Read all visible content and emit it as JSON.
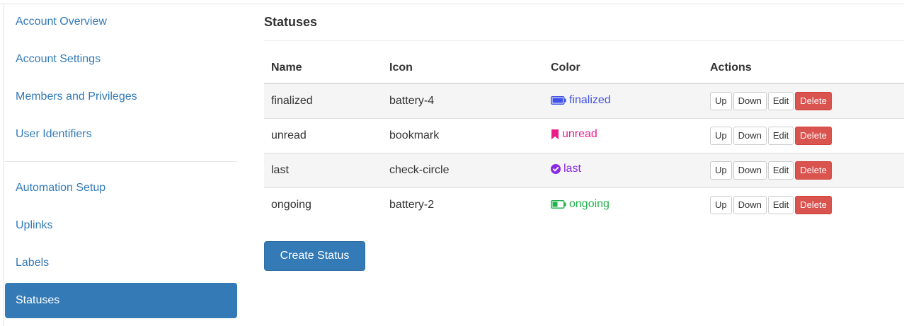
{
  "sidebar": {
    "group1": [
      {
        "label": "Account Overview"
      },
      {
        "label": "Account Settings"
      },
      {
        "label": "Members and Privileges"
      },
      {
        "label": "User Identifiers"
      }
    ],
    "group2": [
      {
        "label": "Automation Setup"
      },
      {
        "label": "Uplinks"
      },
      {
        "label": "Labels"
      },
      {
        "label": "Statuses",
        "active": true
      }
    ]
  },
  "main": {
    "title": "Statuses",
    "table": {
      "headers": [
        "Name",
        "Icon",
        "Color",
        "Actions"
      ],
      "rows": [
        {
          "name": "finalized",
          "icon": "battery-4",
          "color_label": "finalized",
          "color": "#3f51e8",
          "icon_glyph": "battery-full-icon"
        },
        {
          "name": "unread",
          "icon": "bookmark",
          "color_label": "unread",
          "color": "#e91e8c",
          "icon_glyph": "bookmark-icon"
        },
        {
          "name": "last",
          "icon": "check-circle",
          "color_label": "last",
          "color": "#8a2be2",
          "icon_glyph": "check-circle-icon"
        },
        {
          "name": "ongoing",
          "icon": "battery-2",
          "color_label": "ongoing",
          "color": "#22b14c",
          "icon_glyph": "battery-half-icon"
        }
      ]
    },
    "actions": {
      "up": "Up",
      "down": "Down",
      "edit": "Edit",
      "delete": "Delete"
    },
    "create_button": "Create Status"
  },
  "colors": {
    "primary": "#337ab7",
    "danger": "#d9534f"
  }
}
